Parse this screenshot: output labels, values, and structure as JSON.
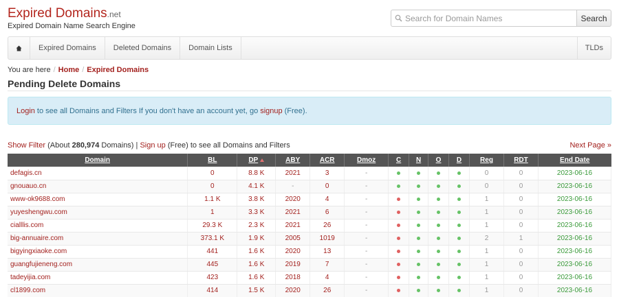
{
  "logo": {
    "main": "Expired Domains",
    "tld": ".net",
    "tagline": "Expired Domain Name Search Engine"
  },
  "search": {
    "placeholder": "Search for Domain Names",
    "button": "Search"
  },
  "nav": {
    "items": [
      "Expired Domains",
      "Deleted Domains",
      "Domain Lists"
    ],
    "right": "TLDs",
    "home_icon": "home-icon"
  },
  "breadcrumb": {
    "prefix": "You are here",
    "home": "Home",
    "current": "Expired Domains"
  },
  "page_title": "Pending Delete Domains",
  "alert": {
    "login": "Login",
    "text1": "to see all Domains and Filters If you don't have an account yet, go",
    "signup": "signup",
    "text2": "(Free)."
  },
  "filterline": {
    "show_filter": "Show Filter",
    "about_pre": "(About",
    "count": "280,974",
    "about_post": "Domains) |",
    "signup": "Sign up",
    "rest": "(Free) to see all Domains and Filters"
  },
  "next_page": "Next Page »",
  "table": {
    "headers": [
      "Domain",
      "BL",
      "DP",
      "ABY",
      "ACR",
      "Dmoz",
      "C",
      "N",
      "O",
      "D",
      "Reg",
      "RDT",
      "End Date"
    ],
    "rows": [
      {
        "domain": "defagis.cn",
        "bl": "0",
        "dp": "8.8 K",
        "aby": "2021",
        "acr": "3",
        "dmoz": "-",
        "c": "green",
        "n": "green",
        "o": "green",
        "d": "green",
        "reg": "0",
        "rdt": "0",
        "end": "2023-06-16"
      },
      {
        "domain": "gnouauo.cn",
        "bl": "0",
        "dp": "4.1 K",
        "aby": "-",
        "acr": "0",
        "dmoz": "-",
        "c": "green",
        "n": "green",
        "o": "green",
        "d": "green",
        "reg": "0",
        "rdt": "0",
        "end": "2023-06-16"
      },
      {
        "domain": "www-ok9688.com",
        "bl": "1.1 K",
        "dp": "3.8 K",
        "aby": "2020",
        "acr": "4",
        "dmoz": "-",
        "c": "red",
        "n": "green",
        "o": "green",
        "d": "green",
        "reg": "1",
        "rdt": "0",
        "end": "2023-06-16"
      },
      {
        "domain": "yuyeshengwu.com",
        "bl": "1",
        "dp": "3.3 K",
        "aby": "2021",
        "acr": "6",
        "dmoz": "-",
        "c": "red",
        "n": "green",
        "o": "green",
        "d": "green",
        "reg": "1",
        "rdt": "0",
        "end": "2023-06-16"
      },
      {
        "domain": "cialllis.com",
        "bl": "29.3 K",
        "dp": "2.3 K",
        "aby": "2021",
        "acr": "26",
        "dmoz": "-",
        "c": "red",
        "n": "green",
        "o": "green",
        "d": "green",
        "reg": "1",
        "rdt": "0",
        "end": "2023-06-16"
      },
      {
        "domain": "big-annuaire.com",
        "bl": "373.1 K",
        "dp": "1.9 K",
        "aby": "2005",
        "acr": "1019",
        "dmoz": "-",
        "c": "red",
        "n": "green",
        "o": "green",
        "d": "green",
        "reg": "2",
        "rdt": "1",
        "end": "2023-06-16"
      },
      {
        "domain": "bigyingxiaoke.com",
        "bl": "441",
        "dp": "1.6 K",
        "aby": "2020",
        "acr": "13",
        "dmoz": "-",
        "c": "red",
        "n": "green",
        "o": "green",
        "d": "green",
        "reg": "1",
        "rdt": "0",
        "end": "2023-06-16"
      },
      {
        "domain": "guangfujieneng.com",
        "bl": "445",
        "dp": "1.6 K",
        "aby": "2019",
        "acr": "7",
        "dmoz": "-",
        "c": "red",
        "n": "green",
        "o": "green",
        "d": "green",
        "reg": "1",
        "rdt": "0",
        "end": "2023-06-16"
      },
      {
        "domain": "tadeyijia.com",
        "bl": "423",
        "dp": "1.6 K",
        "aby": "2018",
        "acr": "4",
        "dmoz": "-",
        "c": "red",
        "n": "green",
        "o": "green",
        "d": "green",
        "reg": "1",
        "rdt": "0",
        "end": "2023-06-16"
      },
      {
        "domain": "cl1899.com",
        "bl": "414",
        "dp": "1.5 K",
        "aby": "2020",
        "acr": "26",
        "dmoz": "-",
        "c": "red",
        "n": "green",
        "o": "green",
        "d": "green",
        "reg": "1",
        "rdt": "0",
        "end": "2023-06-16"
      }
    ]
  },
  "colors": {
    "brand": "#b3261e",
    "link": "#a3211e",
    "header_bg": "#555555",
    "date_green": "#3a9a3a",
    "alert_bg": "#d9edf7"
  }
}
